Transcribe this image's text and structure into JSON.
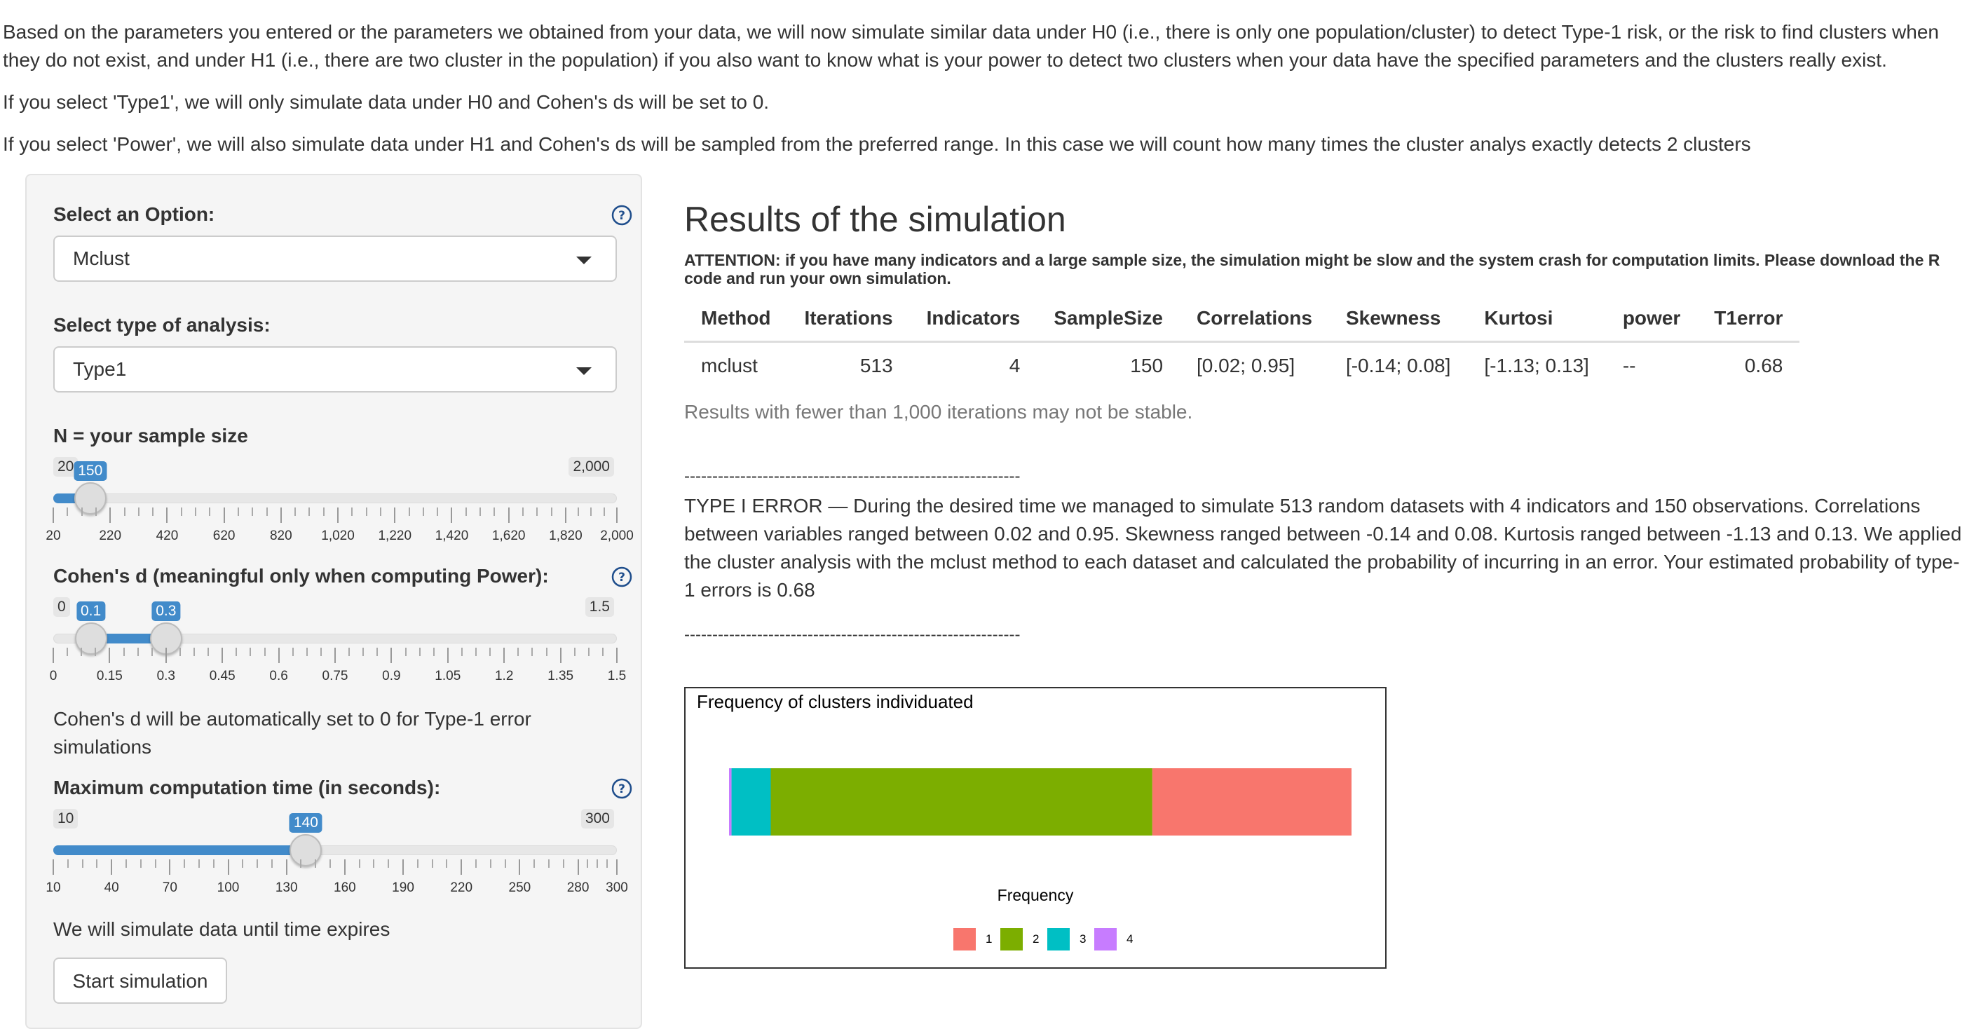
{
  "intro": {
    "p1": "Based on the parameters you entered or the parameters we obtained from your data, we will now simulate similar data under H0 (i.e., there is only one population/cluster) to detect Type-1 risk, or the risk to find clusters when they do not exist, and under H1 (i.e., there are two cluster in the population) if you also want to know what is your power to detect two clusters when your data have the specified parameters and the clusters really exist.",
    "p2": "If you select 'Type1', we will only simulate data under H0 and Cohen's ds will be set to 0.",
    "p3": "If you select 'Power', we will also simulate data under H1 and Cohen's ds will be sampled from the preferred range. In this case we will count how many times the cluster analys exactly detects 2 clusters"
  },
  "sidebar": {
    "option": {
      "label": "Select an Option:",
      "value": "Mclust"
    },
    "analysis": {
      "label": "Select type of analysis:",
      "value": "Type1"
    },
    "sample_size": {
      "label": "N = your sample size",
      "min": 20,
      "max": 2000,
      "value": 150,
      "min_text": "20",
      "max_text": "2,000",
      "value_text": "150",
      "tick_labels": [
        "20",
        "220",
        "420",
        "620",
        "820",
        "1,020",
        "1,220",
        "1,420",
        "1,620",
        "1,820",
        "2,000"
      ]
    },
    "cohens_d": {
      "label": "Cohen's d (meaningful only when computing Power):",
      "min": 0,
      "max": 1.5,
      "low": 0.1,
      "high": 0.3,
      "min_text": "0",
      "max_text": "1.5",
      "low_text": "0.1",
      "high_text": "0.3",
      "tick_labels": [
        "0",
        "0.15",
        "0.3",
        "0.45",
        "0.6",
        "0.75",
        "0.9",
        "1.05",
        "1.2",
        "1.35",
        "1.5"
      ],
      "note": "Cohen's d will be automatically set to 0 for Type-1 error simulations"
    },
    "max_time": {
      "label": "Maximum computation time (in seconds):",
      "min": 10,
      "max": 300,
      "value": 140,
      "min_text": "10",
      "max_text": "300",
      "value_text": "140",
      "tick_labels": [
        "10",
        "40",
        "70",
        "100",
        "130",
        "160",
        "190",
        "220",
        "250",
        "280",
        "300"
      ],
      "note": "We will simulate data until time expires"
    },
    "start_button": "Start simulation"
  },
  "main": {
    "title": "Results of the simulation",
    "attention": "ATTENTION: if you have many indicators and a large sample size, the simulation might be slow and the system crash for computation limits. Please download the R code and run your own simulation.",
    "table": {
      "headers": [
        "Method",
        "Iterations",
        "Indicators",
        "SampleSize",
        "Correlations",
        "Skewness",
        "Kurtosi",
        "power",
        "T1error"
      ],
      "row": [
        "mclust",
        "513",
        "4",
        "150",
        "[0.02; 0.95]",
        "[-0.14; 0.08]",
        "[-1.13; 0.13]",
        "--",
        "0.68"
      ]
    },
    "note": "Results with fewer than 1,000 iterations may not be stable.",
    "separator": "------------------------------------------------------------",
    "summary": "TYPE I ERROR — During the desired time we managed to simulate 513 random datasets with 4 indicators and 150 observations. Correlations between variables ranged between 0.02 and 0.95. Skewness ranged between -0.14 and 0.08. Kurtosis ranged between -1.13 and 0.13. We applied the cluster analysis with the mclust method to each dataset and calculated the probability of incurring in an error. Your estimated probability of type-1 errors is 0.68"
  },
  "chart_data": {
    "type": "bar",
    "orientation": "horizontal-stacked-proportion",
    "title": "Frequency of clusters individuated",
    "legend_title": "Frequency",
    "legend_position": "bottom",
    "categories": [
      "1",
      "2",
      "3",
      "4"
    ],
    "values": [
      0.32,
      0.613,
      0.063,
      0.004
    ],
    "colors": [
      "#F8766D",
      "#7CAE00",
      "#00BFC4",
      "#C77CFF"
    ],
    "stack_order": [
      "4",
      "3",
      "2",
      "1"
    ]
  },
  "colors": {
    "accent": "#428bca",
    "sidebar_bg": "#f5f5f5"
  }
}
